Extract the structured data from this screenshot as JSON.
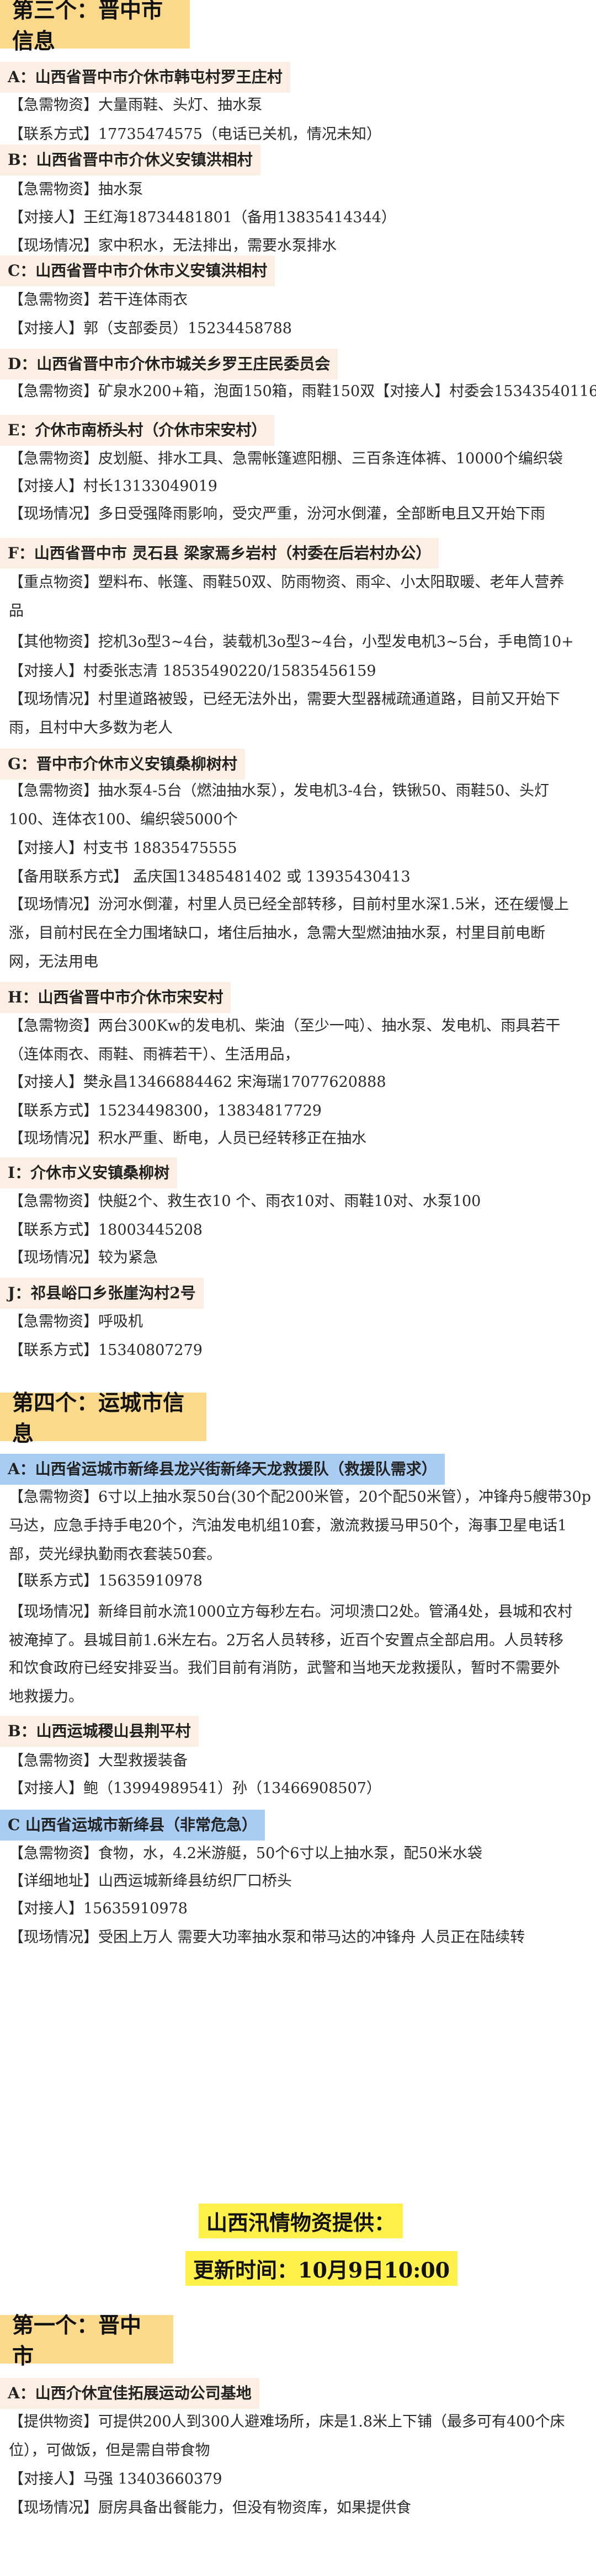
{
  "sec3": {
    "title": "第三个：晋中市信息",
    "items": [
      {
        "head": "A：山西省晋中市介休市韩屯村罗王庄村",
        "lines": [
          "【急需物资】大量雨鞋、头灯、抽水泵",
          "【联系方式】17735474575（电话已关机，情况未知）"
        ]
      },
      {
        "head": "B：山西省晋中市介休义安镇洪相村",
        "lines": [
          "【急需物资】抽水泵",
          "【对接人】王红海18734481801（备用13835414344）",
          "【现场情况】家中积水，无法排出，需要水泵排水"
        ]
      },
      {
        "head": "C：山西省晋中市介休市义安镇洪相村",
        "lines": [
          "【急需物资】若干连体雨衣",
          "【对接人】郭（支部委员）15234458788"
        ]
      },
      {
        "head": "D：山西省晋中市介休市城关乡罗王庄民委员会",
        "lines": [
          "【急需物资】矿泉水200+箱，泡面150箱，雨鞋150双【对接人】村委会15343540116"
        ]
      },
      {
        "head": "E：介休市南桥头村（介休市宋安村）",
        "lines": [
          "【急需物资】皮划艇、排水工具、急需帐篷遮阳棚、三百条连体裤、10000个编织袋",
          "【对接人】村长13133049019",
          "【现场情况】多日受强降雨影响，受灾严重，汾河水倒灌，全部断电且又开始下雨"
        ]
      },
      {
        "head": "F：山西省晋中市 灵石县 梁家焉乡岩村（村委在后岩村办公）",
        "lines": [
          "【重点物资】塑料布、帐篷、雨鞋50双、防雨物资、雨伞、小太阳取暖、老年人营养",
          "品",
          "【其他物资】挖机3o型3~4台，装载机3o型3~4台，小型发电机3~5台，手电筒10+",
          "【对接人】村委张志清 18535490220/15835456159",
          "【现场情况】村里道路被毁，已经无法外出，需要大型器械疏通道路，目前又开始下",
          "雨，且村中大多数为老人"
        ]
      },
      {
        "head": "G：晋中市介休市义安镇桑柳树村",
        "lines": [
          "【急需物资】抽水泵4-5台（燃油抽水泵），发电机3-4台，铁锹50、雨鞋50、头灯",
          "100、连体衣100、编织袋5000个",
          "【对接人】村支书 18835475555",
          "【备用联系方式】 孟庆国13485481402 或 13935430413",
          "【现场情况】汾河水倒灌，村里人员已经全部转移，目前村里水深1.5米，还在缓慢上",
          "涨，目前村民在全力围堵缺口，堵住后抽水，急需大型燃油抽水泵，村里目前电断",
          "网，无法用电"
        ]
      },
      {
        "head": "H：山西省晋中市介休市宋安村",
        "lines": [
          "【急需物资】两台300Kw的发电机、柴油（至少一吨）、抽水泵、发电机、雨具若干",
          "（连体雨衣、雨鞋、雨裤若干）、生活用品，",
          "【对接人】樊永昌13466884462 宋海瑞17077620888",
          "【联系方式】15234498300，13834817729",
          "【现场情况】积水严重、断电，人员已经转移正在抽水"
        ]
      },
      {
        "head": "I：介休市义安镇桑柳树",
        "lines": [
          "【急需物资】快艇2个、救生衣10 个、雨衣10对、雨鞋10对、水泵100",
          "【联系方式】18003445208",
          "【现场情况】较为紧急"
        ]
      },
      {
        "head": "J：祁县峪口乡张崖沟村2号",
        "lines": [
          "【急需物资】呼吸机",
          "【联系方式】15340807279"
        ]
      }
    ]
  },
  "sec4": {
    "title": "第四个：运城市信息",
    "items": [
      {
        "head": "A：山西省运城市新绛县龙兴街新绛天龙救援队（救援队需求）",
        "lines": [
          "【急需物资】6寸以上抽水泵50台(30个配200米管，20个配50米管），冲锋舟5艘带30p",
          "马达，应急手持手电20个，汽油发电机组10套，激流救援马甲50个，海事卫星电话1",
          "部，荧光绿执勤雨衣套装50套。",
          "【联系方式】15635910978",
          "【现场情况】新绛目前水流1000立方每秒左右。河坝溃口2处。管涌4处，县城和农村",
          "被淹掉了。县城目前1.6米左右。2万名人员转移，近百个安置点全部启用。人员转移",
          "和饮食政府已经安排妥当。我们目前有消防，武警和当地天龙救援队，暂时不需要外",
          "地救援力。"
        ]
      },
      {
        "head": "B：山西运城稷山县荆平村",
        "lines": [
          "【急需物资】大型救援装备",
          "【对接人】鲍（13994989541）孙（13466908507）"
        ]
      },
      {
        "head": "C 山西省运城市新绛县（非常危急）",
        "lines": [
          "【急需物资】食物，水，4.2米游艇，50个6寸以上抽水泵，配50米水袋",
          "【详细地址】山西运城新绛县纺织厂口桥头",
          "【对接人】15635910978",
          "【现场情况】受困上万人 需要大功率抽水泵和带马达的冲锋舟 人员正在陆续转"
        ]
      }
    ]
  },
  "supply": {
    "title": "山西汛情物资提供：",
    "updated": "更新时间：10月9日10:00"
  },
  "sec1": {
    "title": "第一个：晋中市",
    "items": [
      {
        "head": "A：山西介休宜佳拓展运动公司基地",
        "lines": [
          "【提供物资】可提供200人到300人避难场所，床是1.8米上下铺（最多可有400个床",
          "位），可做饭，但是需自带食物",
          "【对接人】马强 13403660379",
          "【现场情况】厨房具备出餐能力，但没有物资库，如果提供食"
        ]
      }
    ]
  }
}
